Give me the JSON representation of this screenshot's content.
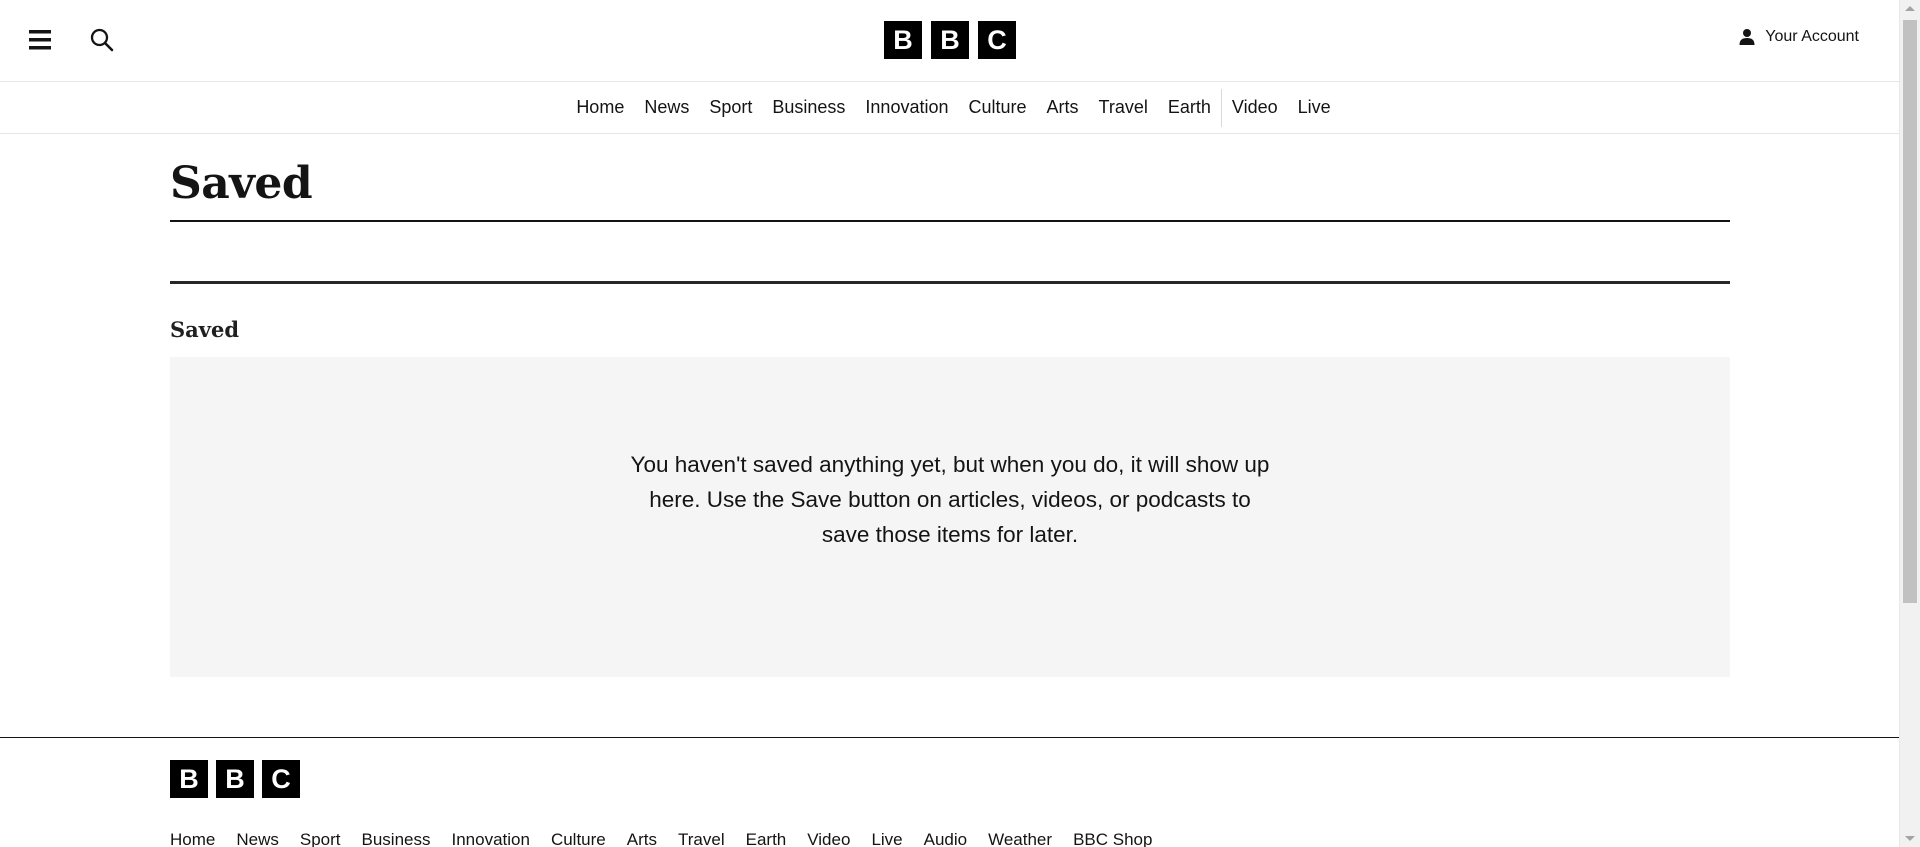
{
  "header": {
    "brand_letters": [
      "B",
      "B",
      "C"
    ],
    "account_label": "Your Account",
    "icons": {
      "menu": "hamburger-menu-icon",
      "search": "search-icon",
      "account": "user-icon"
    }
  },
  "nav": {
    "items": [
      {
        "label": "Home"
      },
      {
        "label": "News"
      },
      {
        "label": "Sport"
      },
      {
        "label": "Business"
      },
      {
        "label": "Innovation"
      },
      {
        "label": "Culture"
      },
      {
        "label": "Arts"
      },
      {
        "label": "Travel"
      },
      {
        "label": "Earth"
      },
      {
        "label": "Video"
      },
      {
        "label": "Live"
      }
    ]
  },
  "main": {
    "page_title": "Saved",
    "section_title": "Saved",
    "empty_message": "You haven't saved anything yet, but when you do, it will show up here. Use the Save button on articles, videos, or podcasts to save those items for later."
  },
  "footer": {
    "brand_letters": [
      "B",
      "B",
      "C"
    ],
    "links": [
      "Home",
      "News",
      "Sport",
      "Business",
      "Innovation",
      "Culture",
      "Arts",
      "Travel",
      "Earth",
      "Video",
      "Live",
      "Audio",
      "Weather",
      "BBC Shop"
    ]
  },
  "colors": {
    "text": "#141414",
    "brand": "#000000",
    "empty_background": "#f5f5f5",
    "divider": "#e6e6e6"
  }
}
